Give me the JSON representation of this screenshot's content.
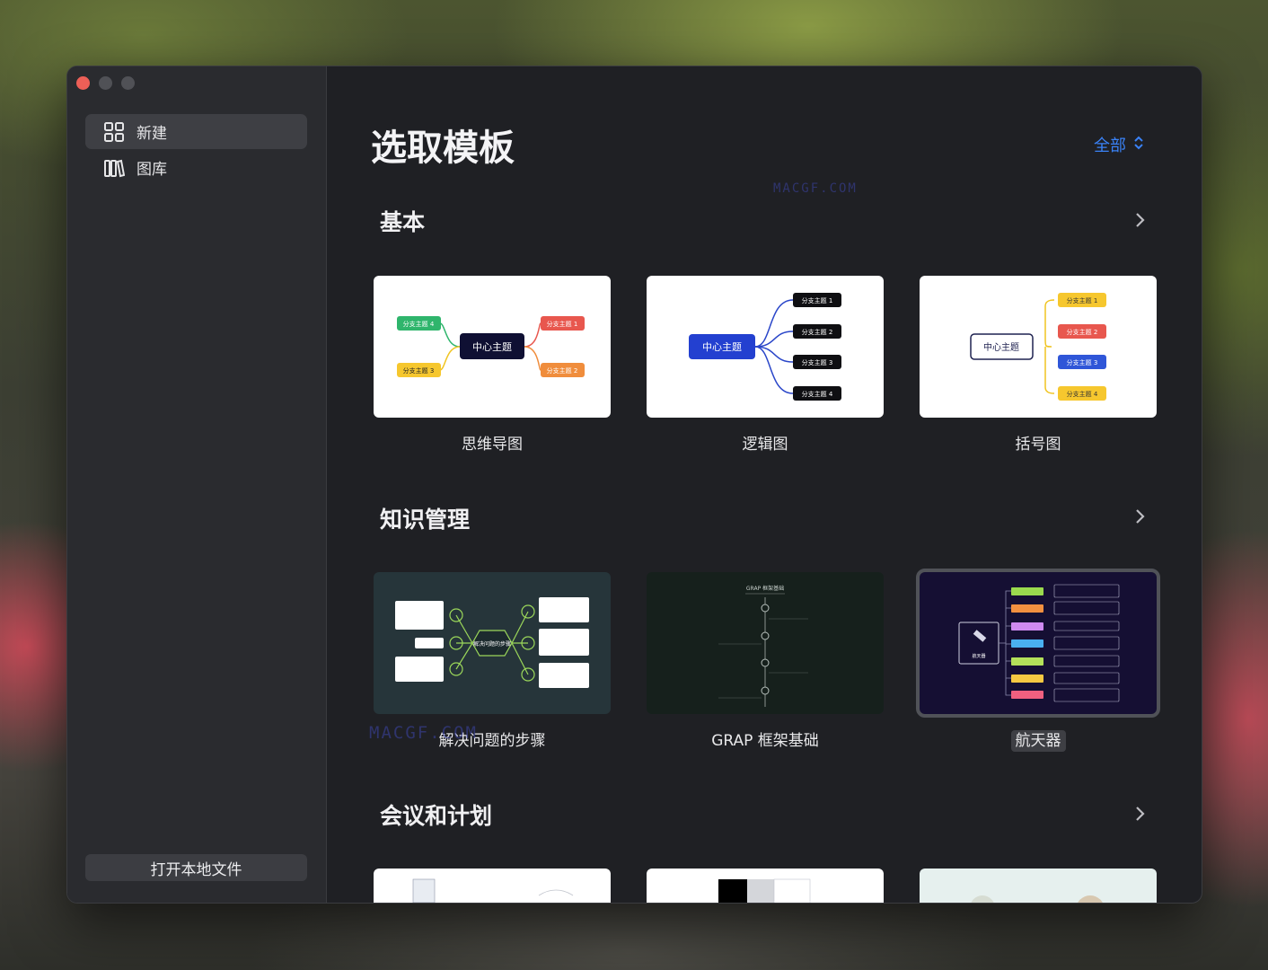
{
  "sidebar": {
    "items": [
      {
        "label": "新建",
        "icon": "grid-icon",
        "active": true
      },
      {
        "label": "图库",
        "icon": "library-icon",
        "active": false
      }
    ],
    "open_local": "打开本地文件"
  },
  "header": {
    "title": "选取模板",
    "filter_label": "全部"
  },
  "sections": [
    {
      "title": "基本",
      "templates": [
        {
          "name": "思维导图"
        },
        {
          "name": "逻辑图"
        },
        {
          "name": "括号图"
        }
      ]
    },
    {
      "title": "知识管理",
      "templates": [
        {
          "name": "解决问题的步骤"
        },
        {
          "name": "GRAP 框架基础"
        },
        {
          "name": "航天器",
          "selected": true
        }
      ]
    },
    {
      "title": "会议和计划",
      "templates": [
        {
          "name": ""
        },
        {
          "name": ""
        },
        {
          "name": ""
        }
      ]
    }
  ],
  "thumbnails": {
    "center": "中心主题",
    "branch1": "分支主题 1",
    "branch2": "分支主题 2",
    "branch3": "分支主题 3",
    "branch4": "分支主题 4",
    "problem_center": "解决问题的步骤",
    "grap_title": "GRAP 框架基础",
    "spacecraft": "航天器"
  },
  "watermark": "MACGF.COM",
  "colors": {
    "accent": "#3a82f6",
    "window_bg": "#1f2024",
    "sidebar_bg": "#2a2b2f"
  }
}
